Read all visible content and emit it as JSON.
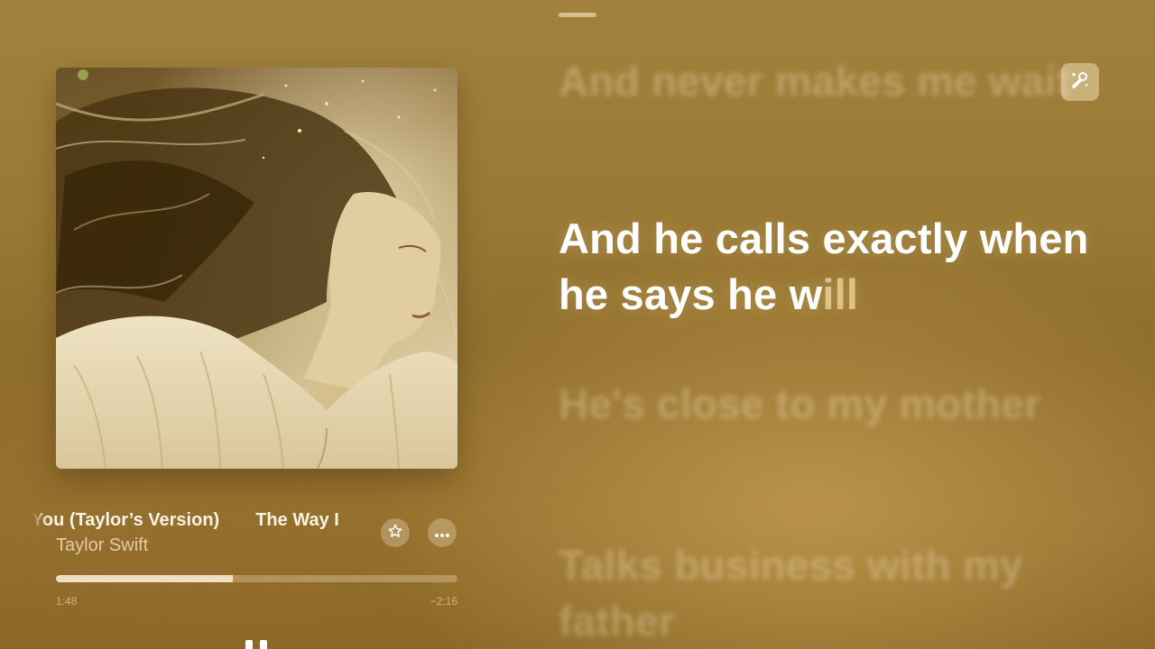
{
  "now_playing": {
    "title": "You (Taylor’s Version)",
    "title_next_segment": "The Way I",
    "artist": "Taylor Swift",
    "artwork_icon": "album-art-icon"
  },
  "progress": {
    "elapsed": "1:48",
    "remaining": "−2:16",
    "fraction": 0.44
  },
  "controls": {
    "favorite_icon": "star-icon",
    "more_icon": "ellipsis-icon",
    "play_pause_icon": "pause-icon",
    "sing_icon": "microphone-sparkle-icon"
  },
  "lyrics": {
    "previous": "And never makes me wait",
    "active_sung": "And he calls exactly when he says he w",
    "active_unsung": "ill",
    "next_1": "He's close to my mother",
    "next_2": "Talks business with my father"
  },
  "colors": {
    "background": "#9a7a35",
    "accent": "#ffffff"
  }
}
